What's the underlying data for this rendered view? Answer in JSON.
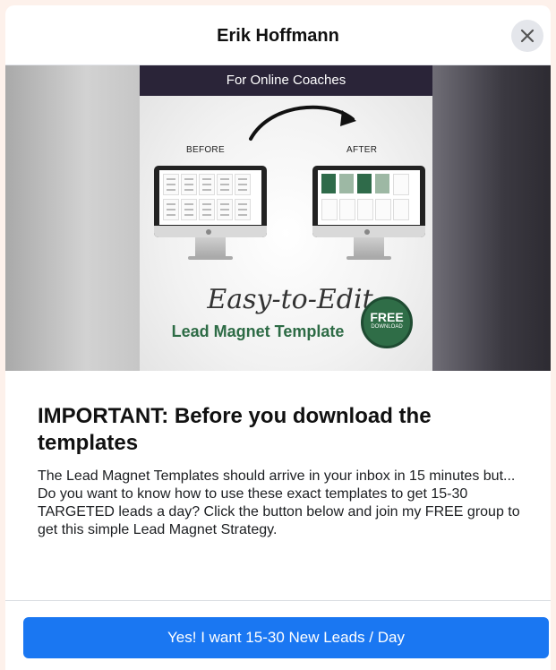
{
  "dialog": {
    "title": "Erik Hoffmann",
    "close_icon": "close-icon"
  },
  "hero": {
    "banner": "For Online Coaches",
    "before_label": "BEFORE",
    "after_label": "AFTER",
    "script_text": "Easy-to-Edit",
    "subtitle": "Lead Magnet Template",
    "badge_top": "FREE",
    "badge_bottom": "DOWNLOAD"
  },
  "content": {
    "heading": "IMPORTANT: Before you download the templates",
    "body": "The Lead Magnet Templates should arrive in your inbox in 15 minutes but... Do you want to know how to use these exact templates to get 15-30 TARGETED leads a day? Click the button below and join my FREE group to get this simple Lead Magnet Strategy."
  },
  "cta": {
    "label": "Yes! I want 15-30 New Leads / Day"
  },
  "colors": {
    "primary_button": "#1a77f2",
    "badge_green": "#2f6d47"
  }
}
